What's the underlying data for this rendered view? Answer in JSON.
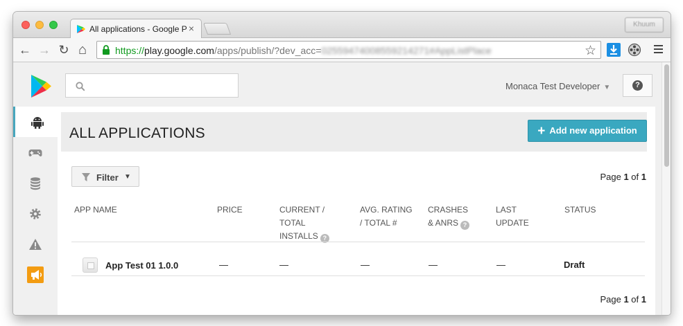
{
  "browser": {
    "tab_title": "All applications - Google Pl",
    "tab_close": "×",
    "profile_name": "Khuum",
    "url_scheme": "https://",
    "url_host": "play.google.com",
    "url_path": "/apps/publish/?dev_acc=",
    "url_obscured": "02559474008559214271#AppListPlace",
    "nav": {
      "back": "←",
      "forward": "→",
      "reload": "↻",
      "home": "⌂"
    },
    "star": "☆"
  },
  "header": {
    "search_placeholder": "",
    "account_name": "Monaca Test Developer",
    "account_caret": "▼",
    "help_label": "?"
  },
  "sidebar": {
    "items": [
      {
        "icon": "android-icon",
        "active": true
      },
      {
        "icon": "gamepad-icon",
        "active": false
      },
      {
        "icon": "database-icon",
        "active": false
      },
      {
        "icon": "gear-icon",
        "active": false
      },
      {
        "icon": "warning-icon",
        "active": false
      },
      {
        "icon": "announcement-icon",
        "active": false
      }
    ]
  },
  "main": {
    "title": "ALL APPLICATIONS",
    "add_button": {
      "plus": "+",
      "label": "Add new application"
    },
    "filter": {
      "label": "Filter",
      "caret": "▼"
    },
    "pager_top": {
      "prefix": "Page",
      "current": "1",
      "of": "of",
      "total": "1"
    },
    "pager_bottom": {
      "prefix": "Page",
      "current": "1",
      "of": "of",
      "total": "1"
    },
    "columns": {
      "app_name": "APP NAME",
      "price": "PRICE",
      "installs_l1": "CURRENT /",
      "installs_l2": "TOTAL",
      "installs_l3": "INSTALLS",
      "rating_l1": "AVG. RATING",
      "rating_l2": "/ TOTAL #",
      "crashes_l1": "CRASHES",
      "crashes_l2": "& ANRS",
      "update_l1": "LAST",
      "update_l2": "UPDATE",
      "status": "STATUS",
      "hint": "?"
    },
    "rows": [
      {
        "name": "App Test 01 1.0.0",
        "price": "—",
        "installs": "—",
        "rating": "—",
        "crashes": "—",
        "last_update": "—",
        "status": "Draft"
      }
    ]
  },
  "colors": {
    "accent": "#3aa8c0",
    "active_nav_bar": "#48a7bd",
    "announcement": "#f39c12",
    "url_secure": "#119a1f"
  }
}
